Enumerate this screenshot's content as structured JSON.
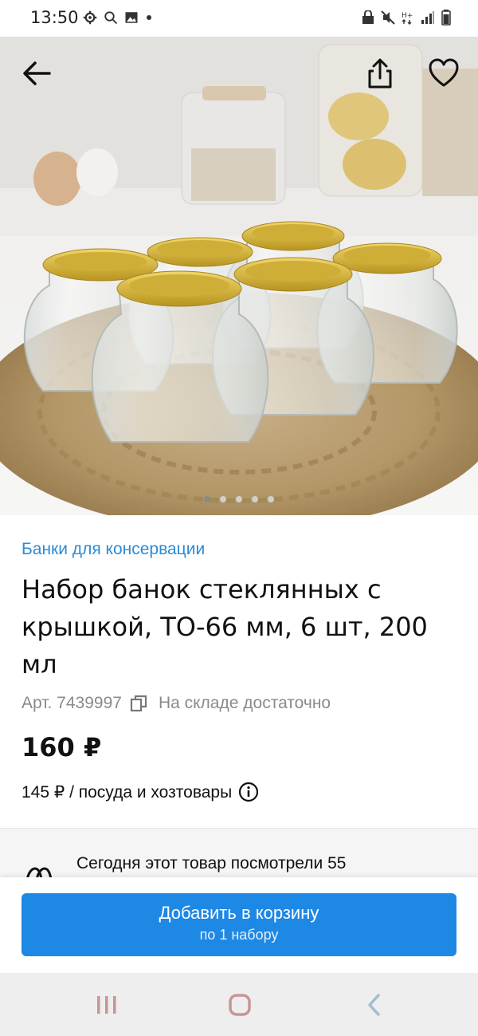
{
  "status_bar": {
    "time": "13:50",
    "left_icons": [
      "gear-icon",
      "search-icon",
      "image-icon",
      "dot-icon"
    ],
    "right_icons": [
      "lock-icon",
      "mute-icon",
      "hplus-icon",
      "signal-icon",
      "battery-icon"
    ]
  },
  "hero": {
    "image_alt": "glass-jars-product-photo",
    "carousel_total": 5,
    "carousel_active": 1
  },
  "product": {
    "category": "Банки для консервации",
    "title": "Набор банок стеклянных с крышкой, ТО-66 мм, 6 шт, 200 мл",
    "article": "Арт. 7439997",
    "stock": "На складе достаточно",
    "price": "160 ₽",
    "price_sub": "145 ₽ / посуда и хозтовары"
  },
  "views": {
    "text": "Сегодня этот товар посмотрели 55"
  },
  "cart_button": {
    "label": "Добавить в корзину",
    "sub_label": "по 1 набору"
  },
  "colors": {
    "accent": "#1e88e5",
    "link": "#2a8bd6",
    "nav_bg": "#eeeeee"
  }
}
